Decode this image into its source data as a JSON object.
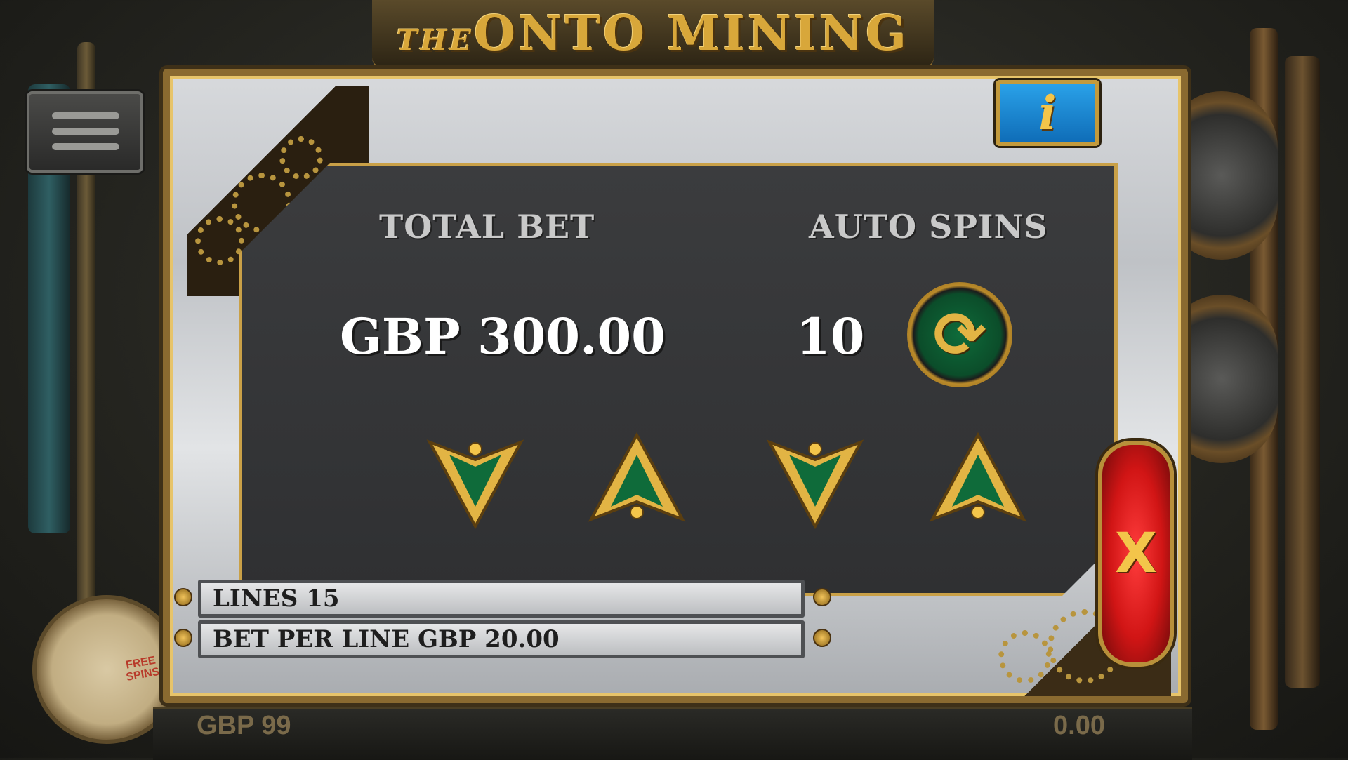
{
  "game": {
    "title_small": "THE",
    "title_main": "ONTO MINING"
  },
  "hud": {
    "balance": "GBP 99",
    "balance_tail": "0",
    "win": "0.00"
  },
  "gauge": {
    "label": "FREE SPINS"
  },
  "settings": {
    "total_bet_label": "TOTAL BET",
    "total_bet_value": "GBP 300.00",
    "auto_spins_label": "AUTO SPINS",
    "auto_spins_value": "10",
    "lines": "LINES 15",
    "bet_per_line": "BET PER LINE GBP 20.00"
  },
  "buttons": {
    "info": "i",
    "close": "X",
    "spin": "⟳"
  },
  "colors": {
    "frame_gold": "#c9a047",
    "panel_dark": "#333436",
    "accent_green": "#0f6b3a",
    "info_blue": "#1a8ad6",
    "close_red": "#d11515"
  }
}
